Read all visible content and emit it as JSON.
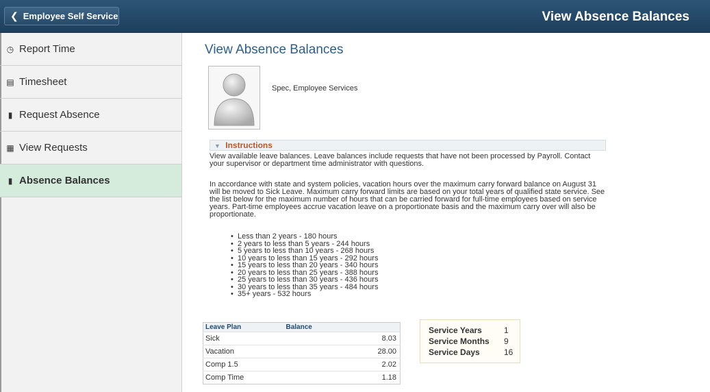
{
  "header": {
    "back_label": "Employee Self Service",
    "title": "View Absence Balances"
  },
  "sidebar": {
    "items": [
      {
        "label": "Report Time",
        "icon": "clock-icon"
      },
      {
        "label": "Timesheet",
        "icon": "calendar-icon"
      },
      {
        "label": "Request Absence",
        "icon": "luggage-icon"
      },
      {
        "label": "View Requests",
        "icon": "calendar-grid-icon"
      },
      {
        "label": "Absence Balances",
        "icon": "luggage-icon",
        "active": true
      }
    ]
  },
  "main": {
    "page_title": "View Absence Balances",
    "employee_name": "Spec, Employee Services",
    "instructions_label": "Instructions",
    "paragraph1": "View available leave balances. Leave balances include requests that have not been processed by Payroll. Contact your supervisor or department time administrator with questions.",
    "paragraph2": "In accordance with state and system policies, vacation hours over the maximum carry forward balance on August 31 will be moved to Sick Leave. Maximum carry forward limits are based on your total years of qualified state service. See the list below for the maximum number of hours that can be carried forward for full-time employees based on service years. Part-time employees accrue vacation leave on a proportionate basis and the maximum carry over will also be proportionate.",
    "tiers": [
      "Less than 2 years - 180 hours",
      "2 years to less than 5 years - 244 hours",
      "5 years to less than 10 years - 268 hours",
      "10 years to less than 15 years - 292 hours",
      "15 years to less than 20 years - 340 hours",
      "20 years to less than 25 years - 388 hours",
      "25 years to less than 30 years - 436 hours",
      "30 years to less than 35 years - 484 hours",
      "35+ years - 532 hours"
    ],
    "balance_table": {
      "headers": [
        "Leave Plan",
        "Balance"
      ],
      "rows": [
        {
          "plan": "Sick",
          "balance": "8.03"
        },
        {
          "plan": "Vacation",
          "balance": "28.00"
        },
        {
          "plan": "Comp 1.5",
          "balance": "2.02"
        },
        {
          "plan": "Comp Time",
          "balance": "1.18"
        }
      ]
    },
    "service": [
      {
        "label": "Service Years",
        "value": "1"
      },
      {
        "label": "Service Months",
        "value": "9"
      },
      {
        "label": "Service Days",
        "value": "16"
      }
    ]
  }
}
